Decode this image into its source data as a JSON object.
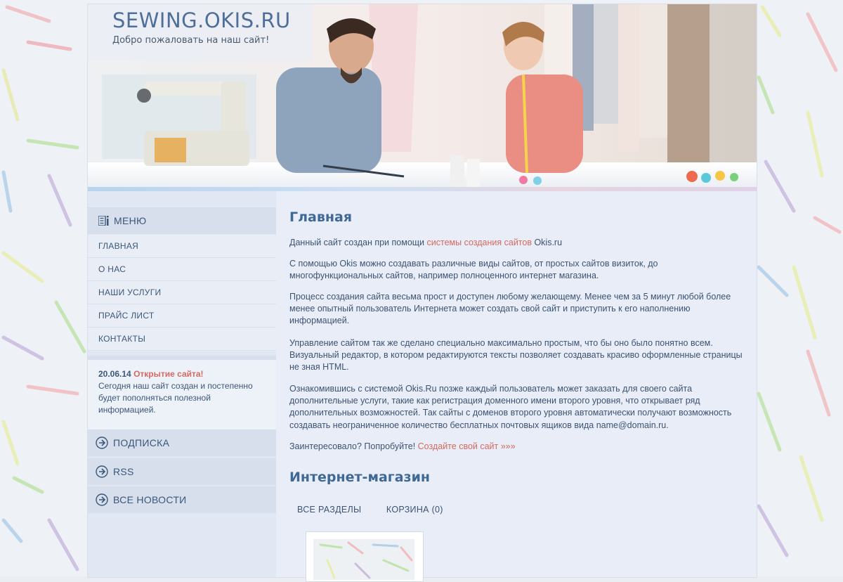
{
  "header": {
    "site_title": "SEWING.OKIS.RU",
    "site_subtitle": "Добро пожаловать на наш сайт!"
  },
  "sidebar": {
    "menu_title": "МЕНЮ",
    "menu_icon": "menu-list-icon",
    "menu_items": [
      {
        "label": "ГЛАВНАЯ"
      },
      {
        "label": "О НАС"
      },
      {
        "label": "НАШИ УСЛУГИ"
      },
      {
        "label": "ПРАЙС ЛИСТ"
      },
      {
        "label": "КОНТАКТЫ"
      }
    ],
    "news": {
      "date": "20.06.14",
      "title": "Открытие сайта!",
      "text": "Сегодня наш сайт создан и постепенно будет пополняться полезной информацией."
    },
    "blocks": [
      {
        "label": "ПОДПИСКА",
        "icon": "circle-arrow-icon"
      },
      {
        "label": "RSS",
        "icon": "circle-arrow-icon"
      },
      {
        "label": "ВСЕ НОВОСТИ",
        "icon": "circle-arrow-icon"
      }
    ]
  },
  "main": {
    "title": "Главная",
    "p1_before": "Данный сайт создан при помощи ",
    "p1_link": "системы создания сайтов",
    "p1_after": " Okis.ru",
    "p2": "С помощью Okis можно создавать различные виды сайтов, от простых сайтов визиток, до многофункциональных сайтов, например полноценного интернет магазина.",
    "p3": "Процесс создания сайта весьма прост и доступен любому желающему. Менее чем за 5 минут любой более менее опытный пользователь Интернета может создать свой сайт и приступить к его наполнению информацией.",
    "p4": "Управление сайтом так же сделано специально максимально простым, что бы оно было понятно всем. Визуальный редактор, в котором редактируются тексты позволяет создавать красиво оформленные страницы не зная HTML.",
    "p5": "Ознакомившись с системой Okis.Ru позже каждый пользователь может заказать для своего сайта дополнительные услуги, такие как регистрация доменного имени второго уровня, что открывает ряд дополнительных возможностей. Так сайты с доменов второго уровня автоматически получают возможность создавать неограниченное количество бесплатных почтовых ящиков вида name@domain.ru.",
    "p6_before": "Заинтересовало? Попробуйте! ",
    "p6_link": "Создайте свой сайт »»»",
    "shop_title": "Интернет-магазин",
    "shop_tabs": [
      "ВСЕ РАЗДЕЛЫ",
      "КОРЗИНА (0)"
    ]
  },
  "colors": {
    "accent_link": "#d46a62",
    "title_blue": "#4f6f9b",
    "text_blue": "#3c5372"
  }
}
